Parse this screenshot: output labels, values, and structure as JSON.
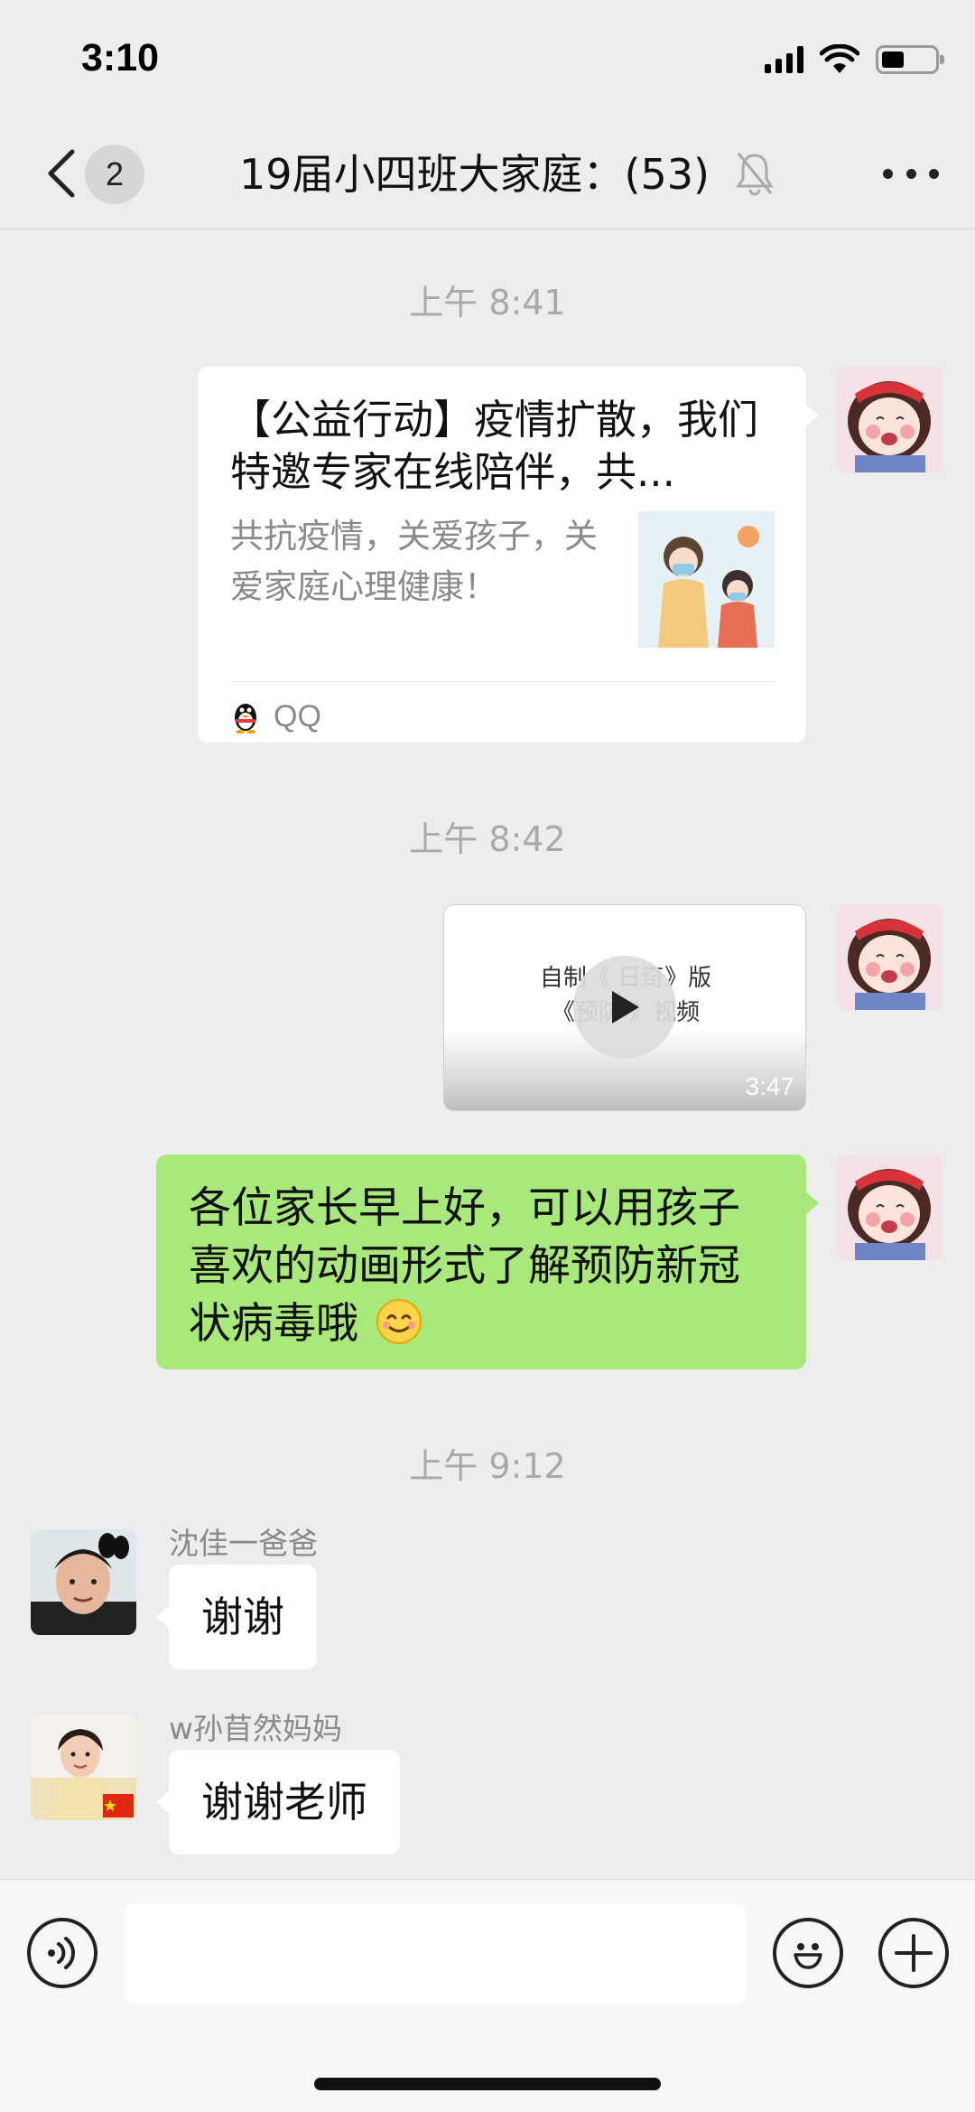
{
  "status_bar": {
    "time": "3:10"
  },
  "nav": {
    "unread_count": "2",
    "title": "19届小四班大家庭：(53)"
  },
  "messages": {
    "ts1": "上午 8:41",
    "card": {
      "title": "【公益行动】疫情扩散，我们特邀专家在线陪伴，共...",
      "desc": "共抗疫情，关爱孩子，关爱家庭心理健康！",
      "source": "QQ"
    },
    "ts2": "上午 8:42",
    "video": {
      "line1": "自制《    日奇》版",
      "line2": "《预防        》视频",
      "duration": "3:47"
    },
    "text_self": "各位家长早上好，可以用孩子喜欢的动画形式了解预防新冠状病毒哦",
    "ts3": "上午 9:12",
    "msg_a": {
      "sender": "沈佳一爸爸",
      "text": "谢谢"
    },
    "msg_b": {
      "sender": "w孙苜然妈妈",
      "text": "谢谢老师"
    }
  },
  "input": {
    "placeholder": ""
  },
  "colors": {
    "background": "#ededed",
    "self_bubble": "#a9e87a",
    "other_bubble": "#ffffff",
    "timestamp": "#a9a9a9"
  },
  "icons": [
    "back-icon",
    "mute-bell-icon",
    "more-icon",
    "qq-penguin-icon",
    "play-icon",
    "smile-emoji",
    "voice-icon",
    "emoji-icon",
    "plus-icon"
  ]
}
